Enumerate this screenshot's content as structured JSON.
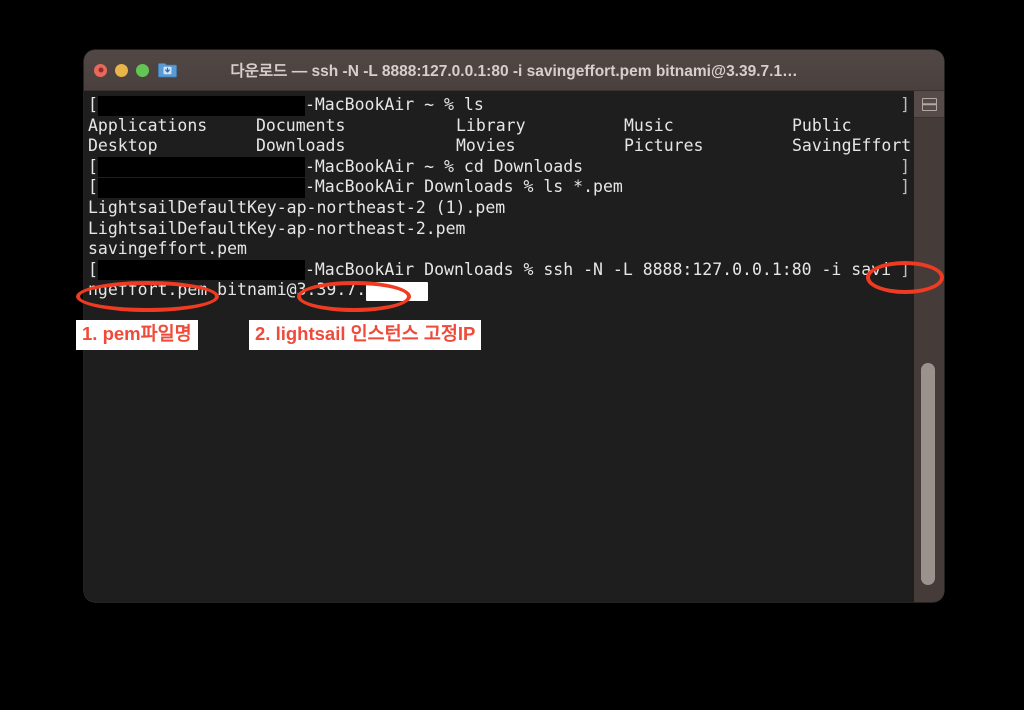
{
  "window": {
    "title": "다운로드 — ssh -N -L 8888:127.0.0.1:80 -i savingeffort.pem bitnami@3.39.7.1…",
    "traffic_lights": {
      "close_label": "close",
      "minimize_label": "minimize",
      "maximize_label": "maximize"
    },
    "folder_icon": "folder-download-icon",
    "split_pane_icon": "split-pane-icon"
  },
  "terminal": {
    "lines": [
      {
        "id": "line-ls-prompt",
        "prefix": "[",
        "redacted_width": 207,
        "text": "-MacBookAir ~ % ls",
        "bracket_right": "]"
      },
      {
        "id": "line-ls-output-row1",
        "columns": [
          "Applications",
          "Documents",
          "Library",
          "Music",
          "Public"
        ]
      },
      {
        "id": "line-ls-output-row2",
        "columns": [
          "Desktop",
          "Downloads",
          "Movies",
          "Pictures",
          "SavingEffort"
        ]
      },
      {
        "id": "line-cd-prompt",
        "prefix": "[",
        "redacted_width": 207,
        "text": "-MacBookAir ~ % cd Downloads",
        "bracket_right": "]"
      },
      {
        "id": "line-lspem-prompt",
        "prefix": "[",
        "redacted_width": 207,
        "text": "-MacBookAir Downloads % ls *.pem",
        "bracket_right": "]"
      },
      {
        "id": "line-pem-1",
        "text": "LightsailDefaultKey-ap-northeast-2 (1).pem"
      },
      {
        "id": "line-pem-2",
        "text": "LightsailDefaultKey-ap-northeast-2.pem"
      },
      {
        "id": "line-pem-3",
        "text": "savingeffort.pem"
      },
      {
        "id": "line-ssh-prompt",
        "prefix": "[",
        "redacted_width": 207,
        "text": "-MacBookAir Downloads % ssh -N -L 8888:127.0.0.1:80 -i savi",
        "bracket_right": "]"
      },
      {
        "id": "line-ssh-wrap",
        "text_part1": "ngeffort.pem bitnami@3.39.7.",
        "redacted_white_width": 62
      }
    ]
  },
  "annotations": {
    "ovals": [
      {
        "id": "oval-savi",
        "name": "highlight-oval-pem-filename-end"
      },
      {
        "id": "oval-pem",
        "name": "highlight-oval-pem-filename"
      },
      {
        "id": "oval-ip",
        "name": "highlight-oval-static-ip"
      }
    ],
    "callouts": [
      {
        "id": "callout-1",
        "text": "1. pem파일명"
      },
      {
        "id": "callout-2",
        "text": "2. lightsail 인스턴스 고정IP"
      }
    ],
    "accent_color": "#ef3b21",
    "callout_text_color": "#ef4a3a"
  }
}
